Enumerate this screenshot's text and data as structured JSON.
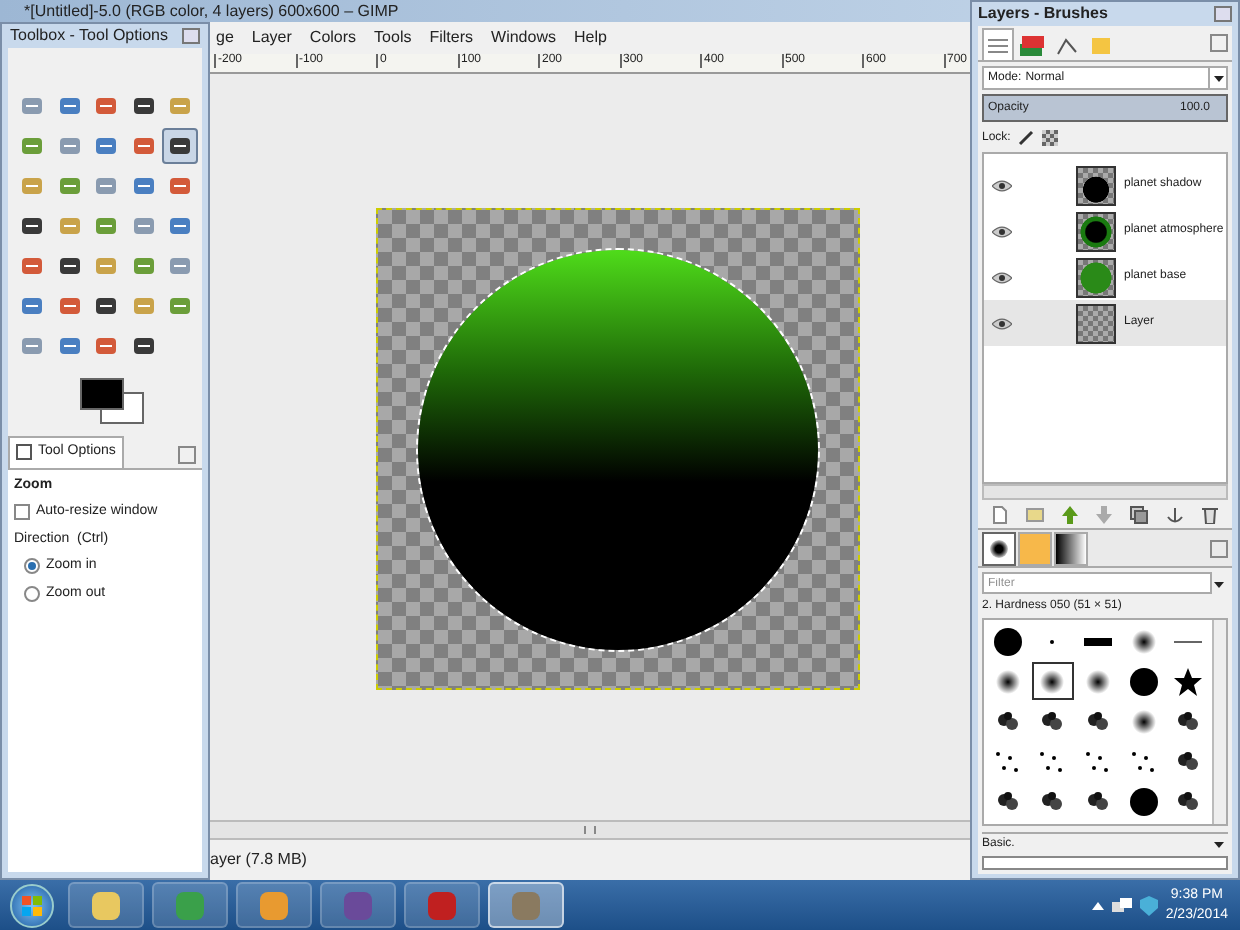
{
  "main_window": {
    "title": "*[Untitled]-5.0 (RGB color, 4 layers) 600x600 – GIMP",
    "menu": [
      "ge",
      "Layer",
      "Colors",
      "Tools",
      "Filters",
      "Windows",
      "Help"
    ],
    "ruler_ticks": [
      "-200",
      "-100",
      "0",
      "100",
      "200",
      "300",
      "400",
      "500",
      "600",
      "700"
    ],
    "status_text": "ayer (7.8 MB)"
  },
  "toolbox": {
    "title": "Toolbox - Tool Options",
    "tools": [
      {
        "selected": false
      },
      {
        "selected": false
      },
      {
        "selected": false
      },
      {
        "selected": false
      },
      {
        "selected": false
      },
      {
        "selected": false
      },
      {
        "selected": false
      },
      {
        "selected": false
      },
      {
        "selected": false
      },
      {
        "selected": true
      },
      {
        "selected": false
      },
      {
        "selected": false
      },
      {
        "selected": false
      },
      {
        "selected": false
      },
      {
        "selected": false
      },
      {
        "selected": false
      },
      {
        "selected": false
      },
      {
        "selected": false
      },
      {
        "selected": false
      },
      {
        "selected": false
      },
      {
        "selected": false
      },
      {
        "selected": false
      },
      {
        "selected": false
      },
      {
        "selected": false
      },
      {
        "selected": false
      },
      {
        "selected": false
      },
      {
        "selected": false
      },
      {
        "selected": false
      },
      {
        "selected": false
      },
      {
        "selected": false
      },
      {
        "selected": false
      },
      {
        "selected": false
      },
      {
        "selected": false
      },
      {
        "selected": false
      }
    ],
    "tab": "Tool Options",
    "section": "Zoom",
    "checkbox": {
      "label": "Auto-resize window",
      "checked": false
    },
    "direction_label": "Direction  (Ctrl)",
    "radios": [
      {
        "label": "Zoom in",
        "selected": true
      },
      {
        "label": "Zoom out",
        "selected": false
      }
    ]
  },
  "layers_window": {
    "title": "Layers - Brushes",
    "mode_label": "Mode:",
    "mode": "Normal",
    "opacity": {
      "label": "Opacity",
      "value": "100.0",
      "level": 1
    },
    "lock_label": "Lock:",
    "layers": [
      {
        "name": "planet shadow",
        "kind": "shadow",
        "visible": true,
        "selected": false
      },
      {
        "name": "planet atmosphere",
        "kind": "atmosphere",
        "visible": true,
        "selected": false
      },
      {
        "name": "planet base",
        "kind": "base",
        "visible": true,
        "selected": false
      },
      {
        "name": "Layer",
        "kind": "empty",
        "visible": true,
        "selected": true
      }
    ],
    "filter_placeholder": "Filter",
    "brush_name": "2. Hardness 050 (51 × 51)",
    "brushes": [
      {
        "kind": "hard",
        "selected": false
      },
      {
        "kind": "dot",
        "selected": false
      },
      {
        "kind": "bar",
        "selected": false
      },
      {
        "kind": "soft",
        "selected": false
      },
      {
        "kind": "line",
        "selected": false
      },
      {
        "kind": "soft",
        "selected": false
      },
      {
        "kind": "soft",
        "selected": true
      },
      {
        "kind": "soft",
        "selected": false
      },
      {
        "kind": "hard",
        "selected": false
      },
      {
        "kind": "star",
        "selected": false
      },
      {
        "kind": "splatter",
        "selected": false
      },
      {
        "kind": "splatter",
        "selected": false
      },
      {
        "kind": "splatter",
        "selected": false
      },
      {
        "kind": "soft",
        "selected": false
      },
      {
        "kind": "splatter",
        "selected": false
      },
      {
        "kind": "scatter",
        "selected": false
      },
      {
        "kind": "scatter",
        "selected": false
      },
      {
        "kind": "scatter",
        "selected": false
      },
      {
        "kind": "scatter",
        "selected": false
      },
      {
        "kind": "splatter",
        "selected": false
      },
      {
        "kind": "splatter",
        "selected": false
      },
      {
        "kind": "splatter",
        "selected": false
      },
      {
        "kind": "splatter",
        "selected": false
      },
      {
        "kind": "hard",
        "selected": false
      },
      {
        "kind": "splatter",
        "selected": false
      }
    ],
    "preset": "Basic."
  },
  "taskbar": {
    "apps": [
      {
        "active": false
      },
      {
        "active": false
      },
      {
        "active": false
      },
      {
        "active": false
      },
      {
        "active": false
      },
      {
        "active": true
      }
    ],
    "time": "9:38 PM",
    "date": "2/23/2014"
  }
}
